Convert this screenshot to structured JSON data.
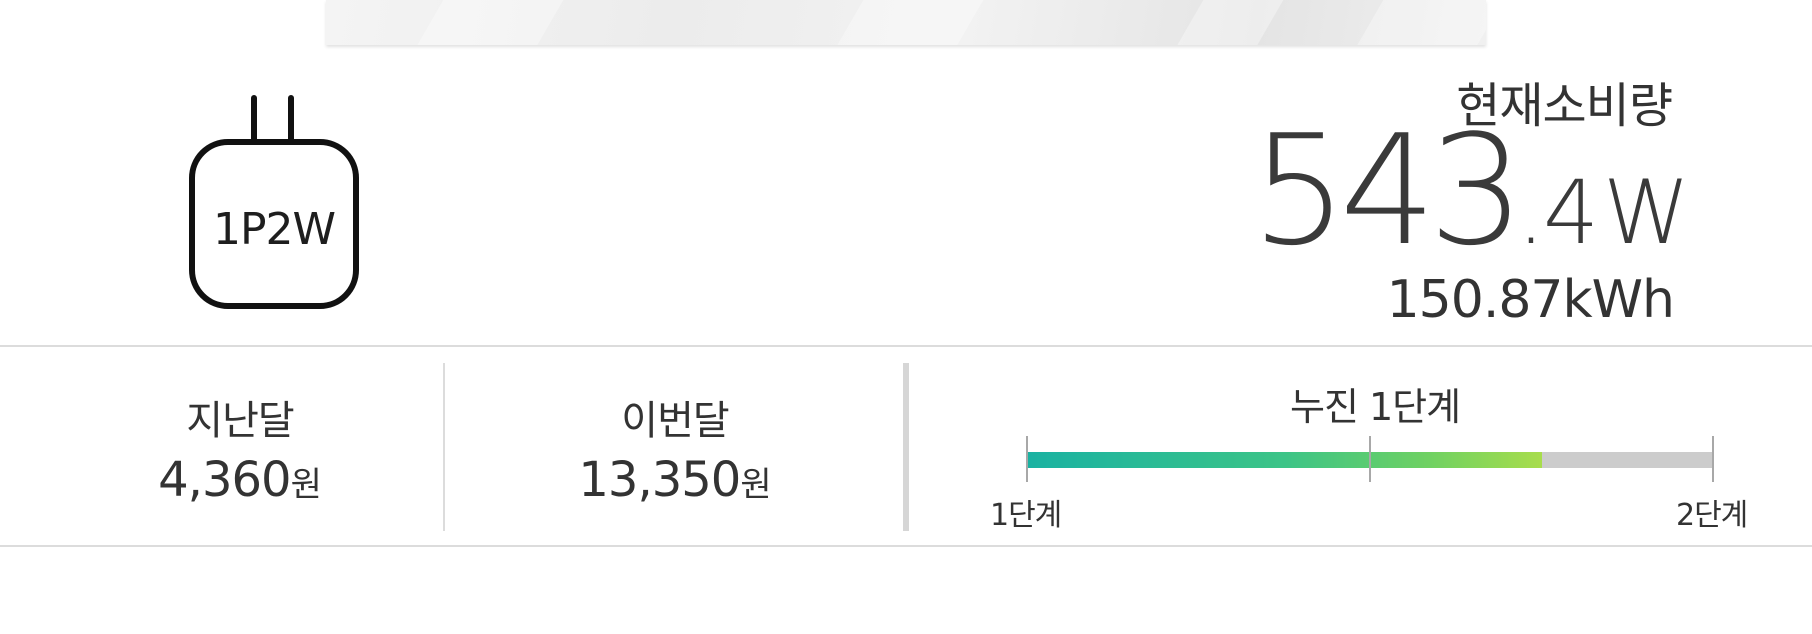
{
  "device": {
    "icon": "plug-icon",
    "type_label": "1P2W"
  },
  "current": {
    "title": "현재소비량",
    "power_int": "543",
    "power_dec": ".4",
    "power_unit": "W",
    "energy": "150.87kWh"
  },
  "last_month": {
    "label": "지난달",
    "amount": "4,360",
    "unit": "원"
  },
  "this_month": {
    "label": "이번달",
    "amount": "13,350",
    "unit": "원"
  },
  "progressive": {
    "title": "누진 1단계",
    "start_label": "1단계",
    "end_label": "2단계",
    "fill_fraction": 0.75,
    "colors": {
      "fill_start": "#1ab2a2",
      "fill_end": "#a8dd4c",
      "track": "#cccccc"
    }
  }
}
